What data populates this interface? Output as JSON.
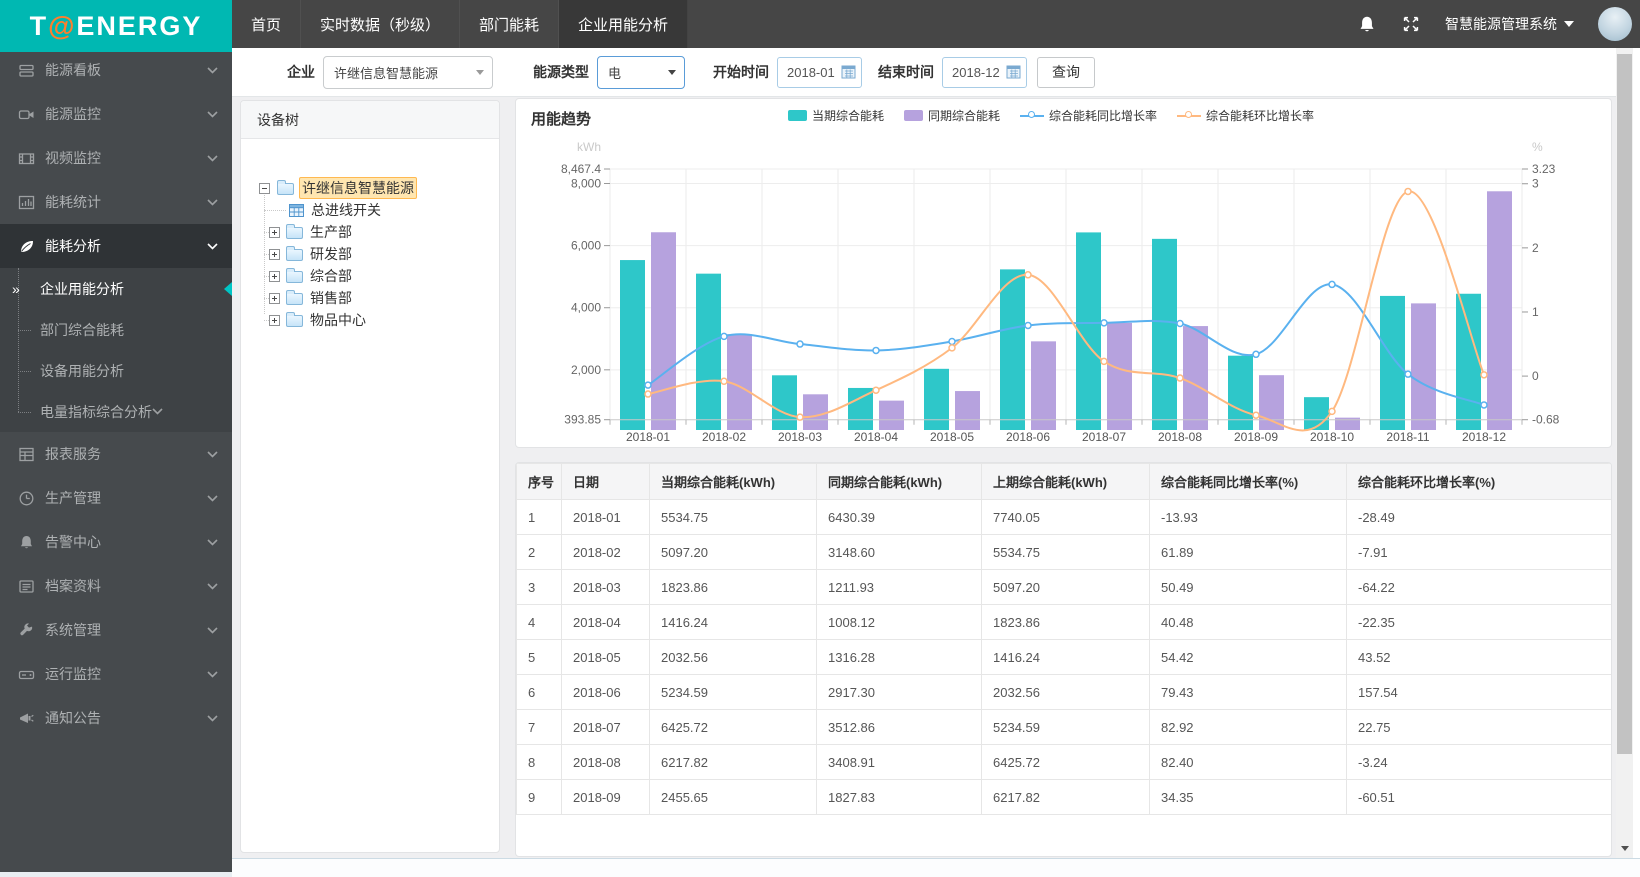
{
  "header": {
    "logo_t": "T",
    "logo_at": "@",
    "logo_rest": "ENERGY",
    "nav": [
      {
        "label": "首页",
        "active": false
      },
      {
        "label": "实时数据（秒级）",
        "active": false
      },
      {
        "label": "部门能耗",
        "active": false
      },
      {
        "label": "企业用能分析",
        "active": true
      }
    ],
    "system_menu": "智慧能源管理系统"
  },
  "sidebar": {
    "groups": [
      {
        "label": "能源看板",
        "icon": "dashboard-icon"
      },
      {
        "label": "能源监控",
        "icon": "camera-icon"
      },
      {
        "label": "视频监控",
        "icon": "film-icon"
      },
      {
        "label": "能耗统计",
        "icon": "stats-icon"
      },
      {
        "label": "能耗分析",
        "icon": "leaf-icon",
        "active": true,
        "expanded": true,
        "children": [
          {
            "label": "企业用能分析",
            "active": true
          },
          {
            "label": "部门综合能耗",
            "active": false
          },
          {
            "label": "设备用能分析",
            "active": false
          },
          {
            "label": "电量指标综合分析",
            "active": false,
            "has_children": true
          }
        ]
      },
      {
        "label": "报表服务",
        "icon": "report-icon"
      },
      {
        "label": "生产管理",
        "icon": "clock-icon"
      },
      {
        "label": "告警中心",
        "icon": "bell-icon"
      },
      {
        "label": "档案资料",
        "icon": "archive-icon"
      },
      {
        "label": "系统管理",
        "icon": "wrench-icon"
      },
      {
        "label": "运行监控",
        "icon": "drive-icon"
      },
      {
        "label": "通知公告",
        "icon": "megaphone-icon"
      }
    ]
  },
  "filters": {
    "company_label": "企业",
    "company_value": "许继信息智慧能源",
    "energy_type_label": "能源类型",
    "energy_type_value": "电",
    "start_label": "开始时间",
    "start_value": "2018-01",
    "end_label": "结束时间",
    "end_value": "2018-12",
    "query_button": "查询"
  },
  "tree": {
    "title": "设备树",
    "root": {
      "label": "许继信息智慧能源",
      "selected": true,
      "expanded": true
    },
    "children": [
      {
        "label": "总进线开关",
        "type": "meter"
      },
      {
        "label": "生产部",
        "type": "folder"
      },
      {
        "label": "研发部",
        "type": "folder"
      },
      {
        "label": "综合部",
        "type": "folder"
      },
      {
        "label": "销售部",
        "type": "folder"
      },
      {
        "label": "物品中心",
        "type": "folder"
      }
    ]
  },
  "chart": {
    "title": "用能趋势",
    "unit_left": "kWh",
    "unit_right": "%",
    "legend": [
      {
        "label": "当期综合能耗",
        "type": "bar",
        "color": "#2ec7c9"
      },
      {
        "label": "同期综合能耗",
        "type": "bar",
        "color": "#b6a2de"
      },
      {
        "label": "综合能耗同比增长率",
        "type": "line",
        "color": "#5ab1ef"
      },
      {
        "label": "综合能耗环比增长率",
        "type": "line",
        "color": "#ffb980"
      }
    ],
    "chart_data": {
      "type": "bar+line",
      "title": "用能趋势",
      "categories": [
        "2018-01",
        "2018-02",
        "2018-03",
        "2018-04",
        "2018-05",
        "2018-06",
        "2018-07",
        "2018-08",
        "2018-09",
        "2018-10",
        "2018-11",
        "2018-12"
      ],
      "series": [
        {
          "name": "当期综合能耗",
          "type": "bar",
          "axis": "left",
          "color": "#2ec7c9",
          "values": [
            5534.75,
            5097.2,
            1823.86,
            1416.24,
            2032.56,
            5234.59,
            6425.72,
            6217.82,
            2455.65,
            1120,
            4380,
            4450
          ]
        },
        {
          "name": "同期综合能耗",
          "type": "bar",
          "axis": "left",
          "color": "#b6a2de",
          "values": [
            6430.39,
            3148.6,
            1211.93,
            1008.12,
            1316.28,
            2917.3,
            3512.86,
            3408.91,
            1827.83,
            460,
            4140,
            7750
          ]
        },
        {
          "name": "综合能耗同比增长率",
          "type": "line",
          "axis": "right",
          "color": "#5ab1ef",
          "values": [
            -0.14,
            0.62,
            0.5,
            0.4,
            0.54,
            0.79,
            0.83,
            0.82,
            0.34,
            1.43,
            0.03,
            -0.45
          ]
        },
        {
          "name": "综合能耗环比增长率",
          "type": "line",
          "axis": "right",
          "color": "#ffb980",
          "values": [
            -0.28,
            -0.08,
            -0.64,
            -0.22,
            0.44,
            1.58,
            0.23,
            -0.03,
            -0.61,
            -0.55,
            2.88,
            0.02
          ]
        }
      ],
      "left_axis": {
        "label": "kWh",
        "min": 393.85,
        "max": 8467.4,
        "ticks": [
          393.85,
          2000,
          4000,
          6000,
          8000,
          8467.4
        ],
        "tick_labels": [
          "393.85",
          "2,000",
          "4,000",
          "6,000",
          "8,000",
          "8,467.4"
        ]
      },
      "right_axis": {
        "label": "%",
        "min": -0.68,
        "max": 3.23,
        "ticks": [
          -0.68,
          0,
          1,
          2,
          3,
          3.23
        ],
        "tick_labels": [
          "-0.68",
          "0",
          "1",
          "2",
          "3",
          "3.23"
        ]
      },
      "grid": true,
      "legend_position": "top"
    }
  },
  "table": {
    "headers": [
      "序号",
      "日期",
      "当期综合能耗(kWh)",
      "同期综合能耗(kWh)",
      "上期综合能耗(kWh)",
      "综合能耗同比增长率(%)",
      "综合能耗环比增长率(%)"
    ],
    "rows": [
      [
        "1",
        "2018-01",
        "5534.75",
        "6430.39",
        "7740.05",
        "-13.93",
        "-28.49"
      ],
      [
        "2",
        "2018-02",
        "5097.20",
        "3148.60",
        "5534.75",
        "61.89",
        "-7.91"
      ],
      [
        "3",
        "2018-03",
        "1823.86",
        "1211.93",
        "5097.20",
        "50.49",
        "-64.22"
      ],
      [
        "4",
        "2018-04",
        "1416.24",
        "1008.12",
        "1823.86",
        "40.48",
        "-22.35"
      ],
      [
        "5",
        "2018-05",
        "2032.56",
        "1316.28",
        "1416.24",
        "54.42",
        "43.52"
      ],
      [
        "6",
        "2018-06",
        "5234.59",
        "2917.30",
        "2032.56",
        "79.43",
        "157.54"
      ],
      [
        "7",
        "2018-07",
        "6425.72",
        "3512.86",
        "5234.59",
        "82.92",
        "22.75"
      ],
      [
        "8",
        "2018-08",
        "6217.82",
        "3408.91",
        "6425.72",
        "82.40",
        "-3.24"
      ],
      [
        "9",
        "2018-09",
        "2455.65",
        "1827.83",
        "6217.82",
        "34.35",
        "-60.51"
      ]
    ]
  },
  "colors": {
    "brand_teal": "#00b8b2",
    "logo_at_orange": "#ff7e2d",
    "bar_current": "#2ec7c9",
    "bar_previous": "#b6a2de",
    "line_yoy": "#5ab1ef",
    "line_mom": "#ffb980",
    "tree_selected_bg": "#ffe6b0",
    "tree_selected_border": "#ffb951"
  }
}
